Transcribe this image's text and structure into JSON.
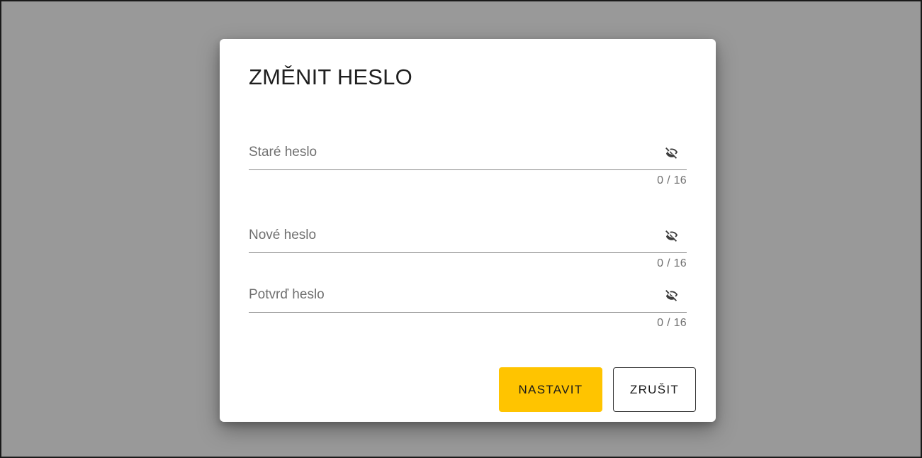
{
  "dialog": {
    "title": "ZMĚNIT HESLO",
    "fields": [
      {
        "label": "Staré heslo",
        "value": "",
        "counter": "0 / 16",
        "icon": "eye-off-icon"
      },
      {
        "label": "Nové heslo",
        "value": "",
        "counter": "0 / 16",
        "icon": "eye-off-icon"
      },
      {
        "label": "Potvrď heslo",
        "value": "",
        "counter": "0 / 16",
        "icon": "eye-off-icon"
      }
    ],
    "buttons": {
      "confirm_label": "NASTAVIT",
      "cancel_label": "ZRUŠIT"
    }
  },
  "colors": {
    "backdrop": "#999999",
    "primary_button": "#ffc400"
  }
}
